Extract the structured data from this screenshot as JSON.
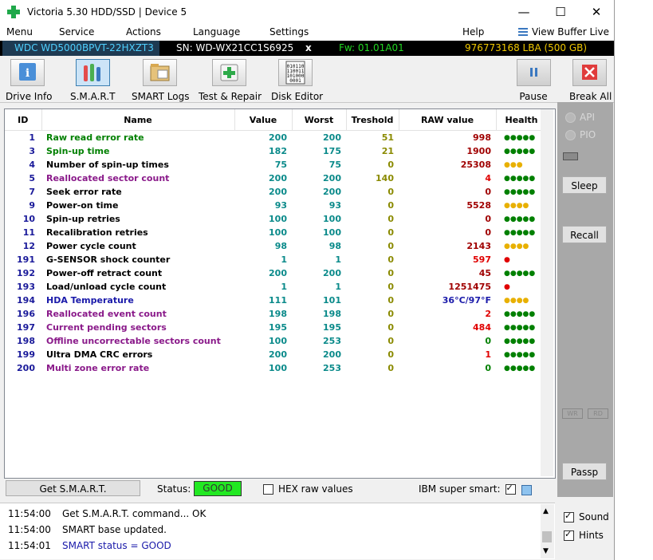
{
  "window": {
    "title": "Victoria 5.30 HDD/SSD | Device 5",
    "min": "—",
    "max": "☐",
    "close": "✕"
  },
  "menu": {
    "items": [
      "Menu",
      "Service",
      "Actions",
      "Language",
      "Settings",
      "Help"
    ],
    "view_buffer": "View Buffer Live"
  },
  "drive": {
    "model": "WDC WD5000BPVT-22HXZT3",
    "sn": "SN: WD-WX21CC1S6925",
    "x": "x",
    "fw": "Fw: 01.01A01",
    "lba": "976773168 LBA (500 GB)"
  },
  "toolbar": {
    "drive_info": "Drive Info",
    "smart": "S.M.A.R.T",
    "smart_logs": "SMART Logs",
    "test_repair": "Test & Repair",
    "disk_editor": "Disk Editor",
    "pause": "Pause",
    "break_all": "Break All"
  },
  "table": {
    "headers": {
      "id": "ID",
      "name": "Name",
      "value": "Value",
      "worst": "Worst",
      "treshold": "Treshold",
      "raw": "RAW value",
      "health": "Health"
    },
    "rows": [
      {
        "id": "1",
        "name": "Raw read error rate",
        "value": "200",
        "worst": "200",
        "treshold": "51",
        "raw": "998",
        "health": "●●●●●",
        "name_color": "#008000",
        "raw_color": "#a00000",
        "health_color": "#008000"
      },
      {
        "id": "3",
        "name": "Spin-up time",
        "value": "182",
        "worst": "175",
        "treshold": "21",
        "raw": "1900",
        "health": "●●●●●",
        "name_color": "#008000",
        "raw_color": "#a00000",
        "health_color": "#008000"
      },
      {
        "id": "4",
        "name": "Number of spin-up times",
        "value": "75",
        "worst": "75",
        "treshold": "0",
        "raw": "25308",
        "health": "●●●",
        "name_color": "#000000",
        "raw_color": "#a00000",
        "health_color": "#e8b000"
      },
      {
        "id": "5",
        "name": "Reallocated sector count",
        "value": "200",
        "worst": "200",
        "treshold": "140",
        "raw": "4",
        "health": "●●●●●",
        "name_color": "#8a1a8a",
        "raw_color": "#e00000",
        "health_color": "#008000"
      },
      {
        "id": "7",
        "name": "Seek error rate",
        "value": "200",
        "worst": "200",
        "treshold": "0",
        "raw": "0",
        "health": "●●●●●",
        "name_color": "#000000",
        "raw_color": "#a00000",
        "health_color": "#008000"
      },
      {
        "id": "9",
        "name": "Power-on time",
        "value": "93",
        "worst": "93",
        "treshold": "0",
        "raw": "5528",
        "health": "●●●●",
        "name_color": "#000000",
        "raw_color": "#a00000",
        "health_color": "#e8b000"
      },
      {
        "id": "10",
        "name": "Spin-up retries",
        "value": "100",
        "worst": "100",
        "treshold": "0",
        "raw": "0",
        "health": "●●●●●",
        "name_color": "#000000",
        "raw_color": "#a00000",
        "health_color": "#008000"
      },
      {
        "id": "11",
        "name": "Recalibration retries",
        "value": "100",
        "worst": "100",
        "treshold": "0",
        "raw": "0",
        "health": "●●●●●",
        "name_color": "#000000",
        "raw_color": "#a00000",
        "health_color": "#008000"
      },
      {
        "id": "12",
        "name": "Power cycle count",
        "value": "98",
        "worst": "98",
        "treshold": "0",
        "raw": "2143",
        "health": "●●●●",
        "name_color": "#000000",
        "raw_color": "#a00000",
        "health_color": "#e8b000"
      },
      {
        "id": "191",
        "name": "G-SENSOR shock counter",
        "value": "1",
        "worst": "1",
        "treshold": "0",
        "raw": "597",
        "health": "●",
        "name_color": "#000000",
        "raw_color": "#e00000",
        "health_color": "#e00000"
      },
      {
        "id": "192",
        "name": "Power-off retract count",
        "value": "200",
        "worst": "200",
        "treshold": "0",
        "raw": "45",
        "health": "●●●●●",
        "name_color": "#000000",
        "raw_color": "#a00000",
        "health_color": "#008000"
      },
      {
        "id": "193",
        "name": "Load/unload cycle count",
        "value": "1",
        "worst": "1",
        "treshold": "0",
        "raw": "1251475",
        "health": "●",
        "name_color": "#000000",
        "raw_color": "#a00000",
        "health_color": "#e00000"
      },
      {
        "id": "194",
        "name": "HDA Temperature",
        "value": "111",
        "worst": "101",
        "treshold": "0",
        "raw": "36°C/97°F",
        "health": "●●●●",
        "name_color": "#1a1aaa",
        "raw_color": "#1a1aaa",
        "health_color": "#e8b000"
      },
      {
        "id": "196",
        "name": "Reallocated event count",
        "value": "198",
        "worst": "198",
        "treshold": "0",
        "raw": "2",
        "health": "●●●●●",
        "name_color": "#8a1a8a",
        "raw_color": "#e00000",
        "health_color": "#008000"
      },
      {
        "id": "197",
        "name": "Current pending sectors",
        "value": "195",
        "worst": "195",
        "treshold": "0",
        "raw": "484",
        "health": "●●●●●",
        "name_color": "#8a1a8a",
        "raw_color": "#e00000",
        "health_color": "#008000"
      },
      {
        "id": "198",
        "name": "Offline uncorrectable sectors count",
        "value": "100",
        "worst": "253",
        "treshold": "0",
        "raw": "0",
        "health": "●●●●●",
        "name_color": "#8a1a8a",
        "raw_color": "#008000",
        "health_color": "#008000"
      },
      {
        "id": "199",
        "name": "Ultra DMA CRC errors",
        "value": "200",
        "worst": "200",
        "treshold": "0",
        "raw": "1",
        "health": "●●●●●",
        "name_color": "#000000",
        "raw_color": "#e00000",
        "health_color": "#008000"
      },
      {
        "id": "200",
        "name": "Multi zone error rate",
        "value": "100",
        "worst": "253",
        "treshold": "0",
        "raw": "0",
        "health": "●●●●●",
        "name_color": "#8a1a8a",
        "raw_color": "#008000",
        "health_color": "#008000"
      }
    ]
  },
  "right_panel": {
    "api": "API",
    "pio": "PIO",
    "sleep": "Sleep",
    "recall": "Recall",
    "wr": "WR",
    "rd": "RD",
    "passp": "Passp"
  },
  "status": {
    "get_smart": "Get S.M.A.R.T.",
    "label": "Status:",
    "value": "GOOD",
    "hex": "HEX raw values",
    "ibm": "IBM super smart:"
  },
  "log": [
    {
      "time": "11:54:00",
      "msg": "Get S.M.A.R.T. command... OK",
      "color": "#000000"
    },
    {
      "time": "11:54:00",
      "msg": "SMART base updated.",
      "color": "#000000"
    },
    {
      "time": "11:54:01",
      "msg": "SMART status = GOOD",
      "color": "#1a1aaa"
    }
  ],
  "options": {
    "sound": "Sound",
    "hints": "Hints"
  }
}
